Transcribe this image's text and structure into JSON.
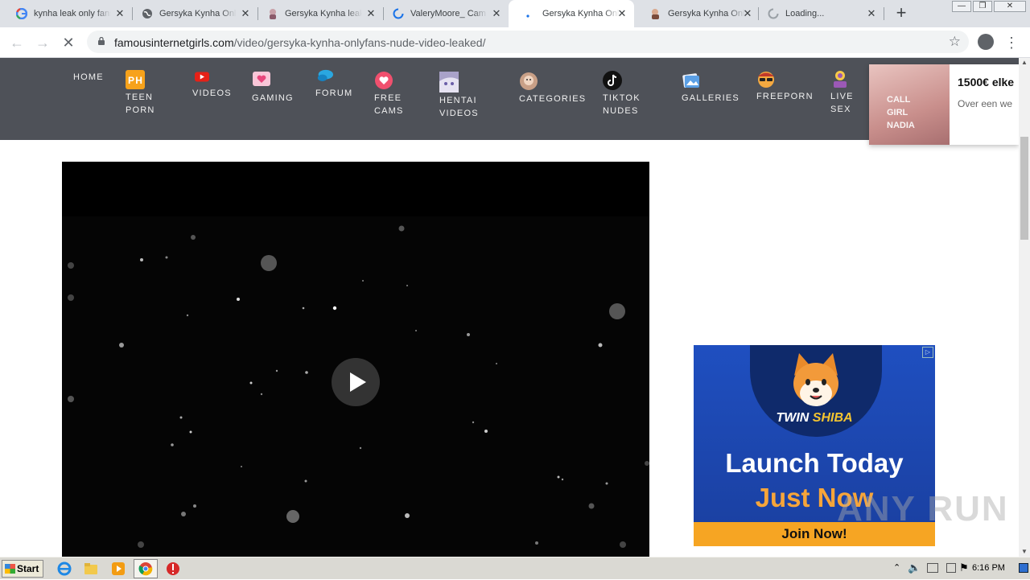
{
  "tabs": [
    {
      "title": "kynha leak only fans",
      "icon": "google-icon"
    },
    {
      "title": "Gersyka Kynha OnlyFans",
      "icon": "globe-icon"
    },
    {
      "title": "Gersyka Kynha leaked",
      "icon": "site-favicon-icon"
    },
    {
      "title": "ValeryMoore_ Cam",
      "icon": "loading-spinner-icon"
    },
    {
      "title": "Gersyka Kynha OnlyFans",
      "icon": "loading-spinner-icon"
    },
    {
      "title": "Gersyka Kynha OnlyFans",
      "icon": "site-favicon-icon"
    },
    {
      "title": "Loading...",
      "icon": "loading-spinner-icon"
    }
  ],
  "active_tab": 4,
  "address_bar": {
    "domain": "famousinternetgirls.com",
    "path": "/video/gersyka-kynha-onlyfans-nude-video-leaked/"
  },
  "site_nav": {
    "items": [
      {
        "label": "HOME",
        "icon": ""
      },
      {
        "label": "TEEN\nPORN",
        "icon": "ph-icon"
      },
      {
        "label": "VIDEOS",
        "icon": "youtube-icon"
      },
      {
        "label": "GAMING",
        "icon": "heart-screen-icon"
      },
      {
        "label": "FORUM",
        "icon": "chat-bubble-icon"
      },
      {
        "label": "FREE\nCAMS",
        "icon": "heart-icon"
      },
      {
        "label": "HENTAI\nVIDEOS",
        "icon": "anime-face-icon"
      },
      {
        "label": "CATEGORIES",
        "icon": "avatar-face-icon"
      },
      {
        "label": "TIKTOK\nNUDES",
        "icon": "tiktok-icon"
      },
      {
        "label": "GALLERIES",
        "icon": "photos-icon"
      },
      {
        "label": "FREEPORN",
        "icon": "glasses-face-icon"
      },
      {
        "label": "LIVE\nSEX",
        "icon": "live-cam-icon"
      }
    ]
  },
  "promo": {
    "title": "1500€ elke",
    "subtitle": "Over een we",
    "thumb_text": "CALL\nGIRL\nNADIA"
  },
  "ad": {
    "brand_a": "TWIN ",
    "brand_b": "SHIBA",
    "line1": "Launch Today",
    "line2": "Just Now",
    "cta": "Join Now!"
  },
  "watermark": "ANY  RUN",
  "taskbar": {
    "start_label": "Start",
    "clock": "6:16 PM"
  }
}
